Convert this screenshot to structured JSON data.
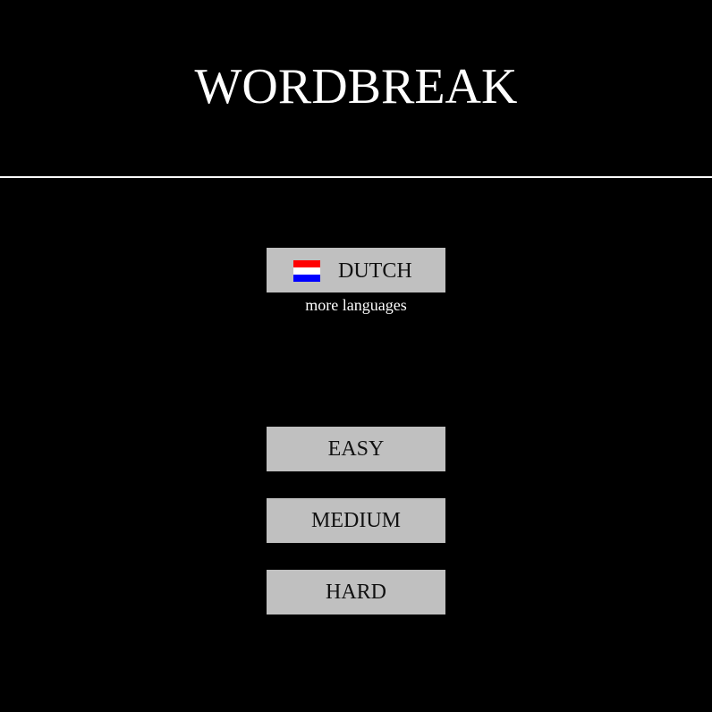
{
  "game": {
    "title": "WORDBREAK"
  },
  "language": {
    "selected_label": "DUTCH",
    "flag_icon": "netherlands-flag-icon",
    "flag_colors": [
      "#ff0000",
      "#ffffff",
      "#0000ff"
    ],
    "more_languages_label": "more languages"
  },
  "difficulty": {
    "easy_label": "EASY",
    "medium_label": "MEDIUM",
    "hard_label": "HARD"
  },
  "colors": {
    "background": "#000000",
    "button": "#c0c0c0",
    "text_light": "#ffffff",
    "text_dark": "#111111"
  }
}
